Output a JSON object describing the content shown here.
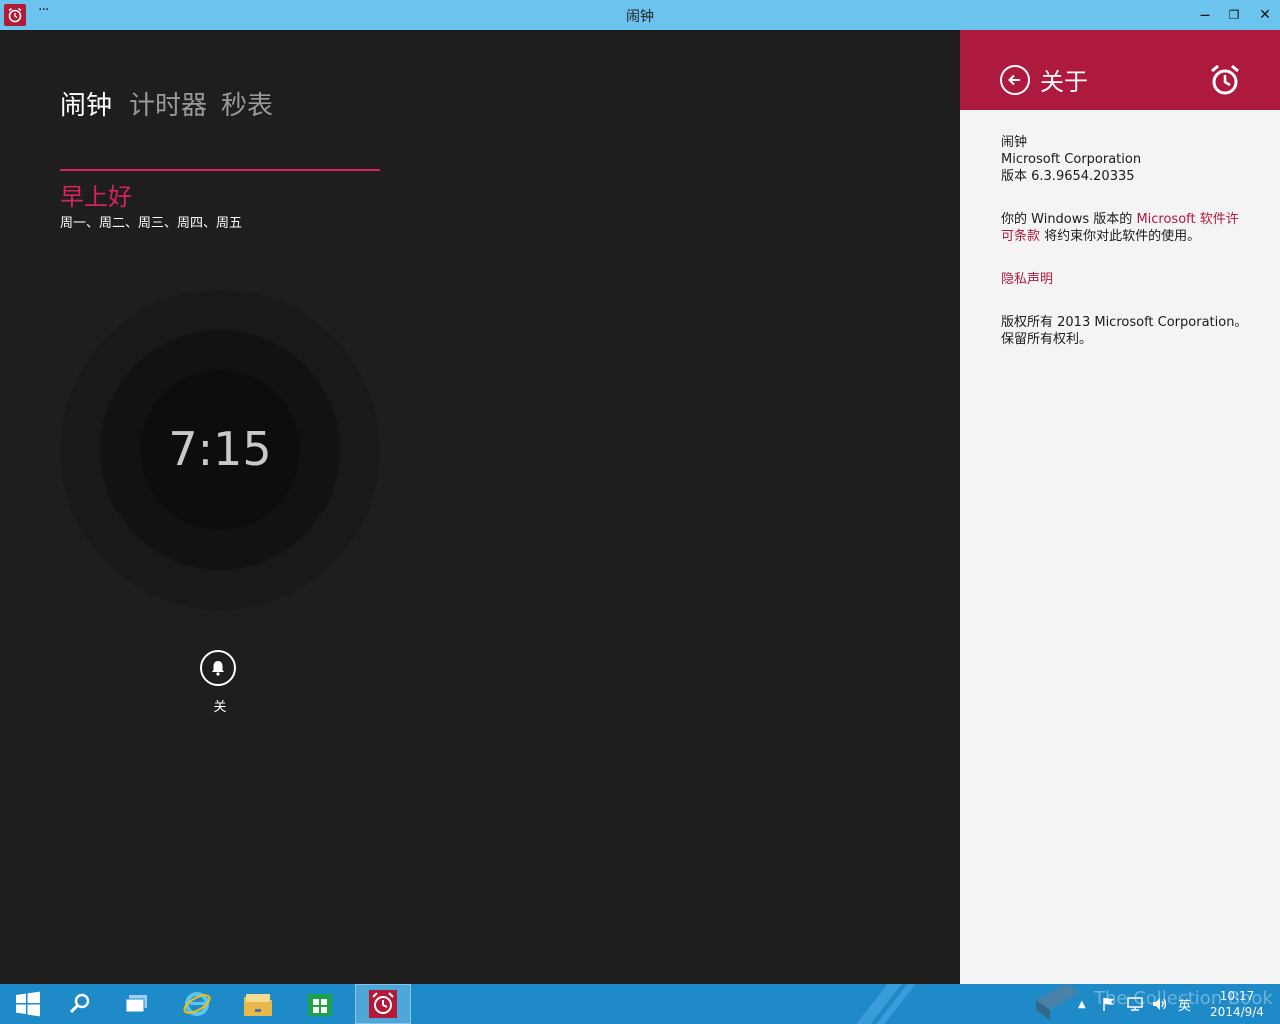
{
  "window": {
    "title": "闹钟",
    "menu_glyph": "···",
    "minimize_glyph": "—",
    "restore_glyph": "❐",
    "close_glyph": "✕"
  },
  "tabs": [
    {
      "label": "闹钟",
      "active": true
    },
    {
      "label": "计时器",
      "active": false
    },
    {
      "label": "秒表",
      "active": false
    }
  ],
  "alarm": {
    "name": "早上好",
    "days": "周一、周二、周三、周四、周五",
    "time": "7:15",
    "toggle_label": "关"
  },
  "about": {
    "title": "关于",
    "app_name": "闹钟",
    "company": "Microsoft Corporation",
    "version": "版本 6.3.9654.20335",
    "license_prefix": "你的 Windows 版本的 ",
    "license_link": "Microsoft 软件许可条款",
    "license_suffix": " 将约束你对此软件的使用。",
    "privacy_link": "隐私声明",
    "copyright": "版权所有 2013 Microsoft Corporation。保留所有权利。"
  },
  "taskbar": {
    "apps": [
      "start-icon",
      "search-icon",
      "task-view-icon",
      "internet-explorer-icon",
      "file-explorer-icon",
      "store-icon",
      "alarms-icon"
    ],
    "tray": {
      "input_language": "英",
      "time": "10:17",
      "date": "2014/9/4"
    },
    "watermark": "The Collection Book"
  },
  "colors": {
    "accent": "#ad1a3d",
    "alarm_accent": "#d6245b",
    "titlebar": "#6cc3ee",
    "taskbar": "#1f8ac8",
    "app_bg": "#1e1e1e",
    "pane_bg": "#f4f4f4"
  }
}
